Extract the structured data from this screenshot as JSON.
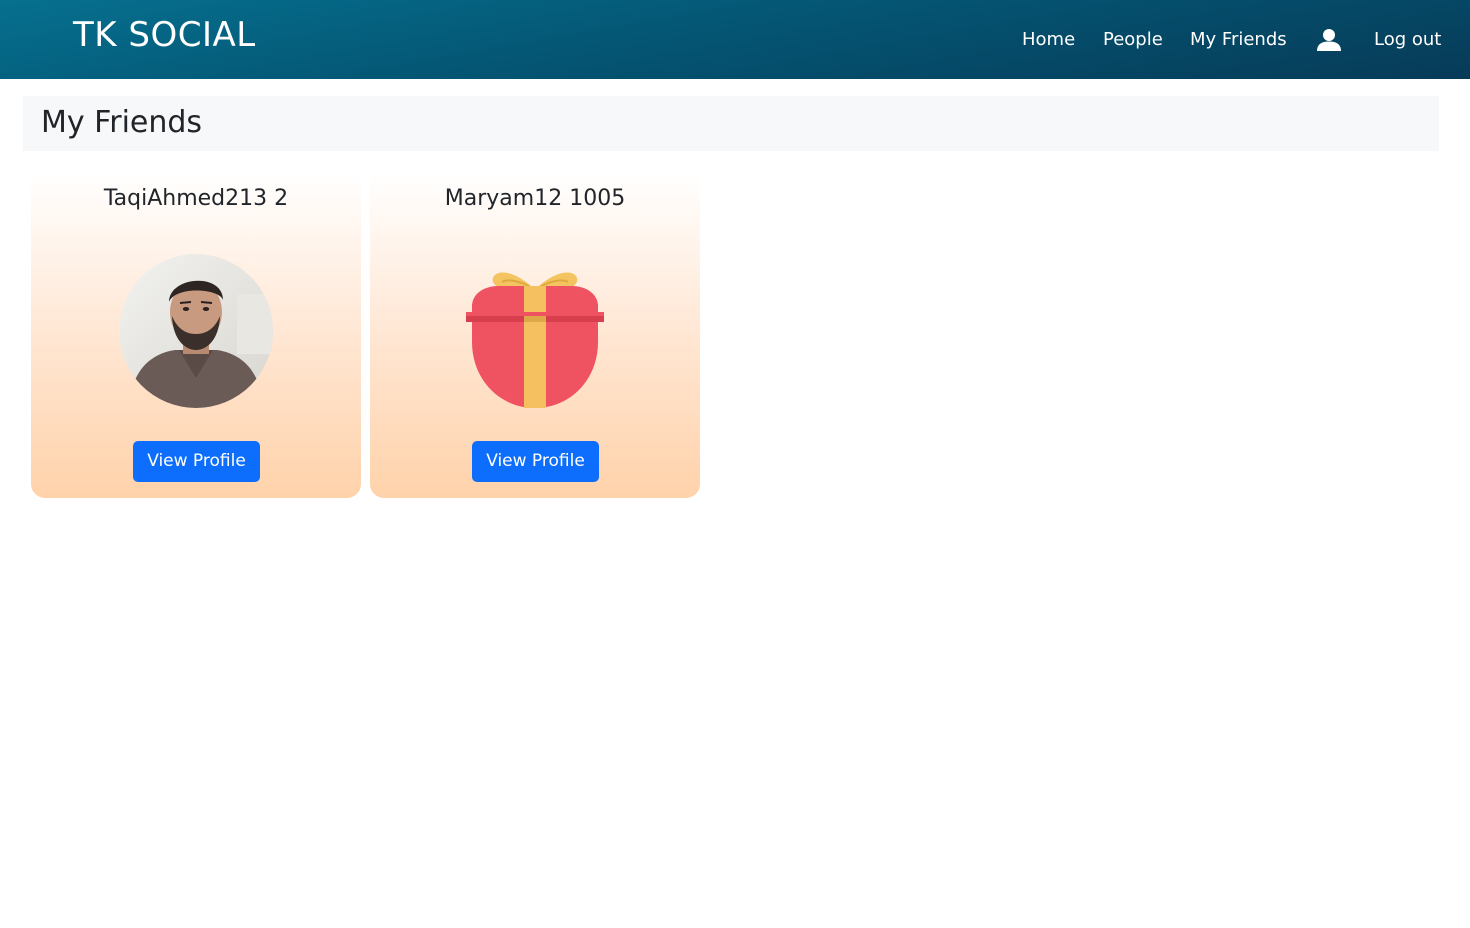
{
  "navbar": {
    "brand": "TK SOCIAL",
    "links": {
      "home": "Home",
      "people": "People",
      "my_friends": "My Friends",
      "logout": "Log out"
    },
    "profile_icon": "user-icon",
    "background_color": "#045674"
  },
  "page": {
    "title": "My Friends"
  },
  "friends": [
    {
      "name": "TaqiAhmed213 2",
      "avatar": "profile-photo",
      "button_label": "View Profile"
    },
    {
      "name": "Maryam12 1005",
      "avatar": "gift-icon",
      "button_label": "View Profile"
    }
  ],
  "colors": {
    "button": "#0d6efd",
    "card_gradient_bottom": "#ffd2aa",
    "header_bar": "#f7f8fa"
  }
}
